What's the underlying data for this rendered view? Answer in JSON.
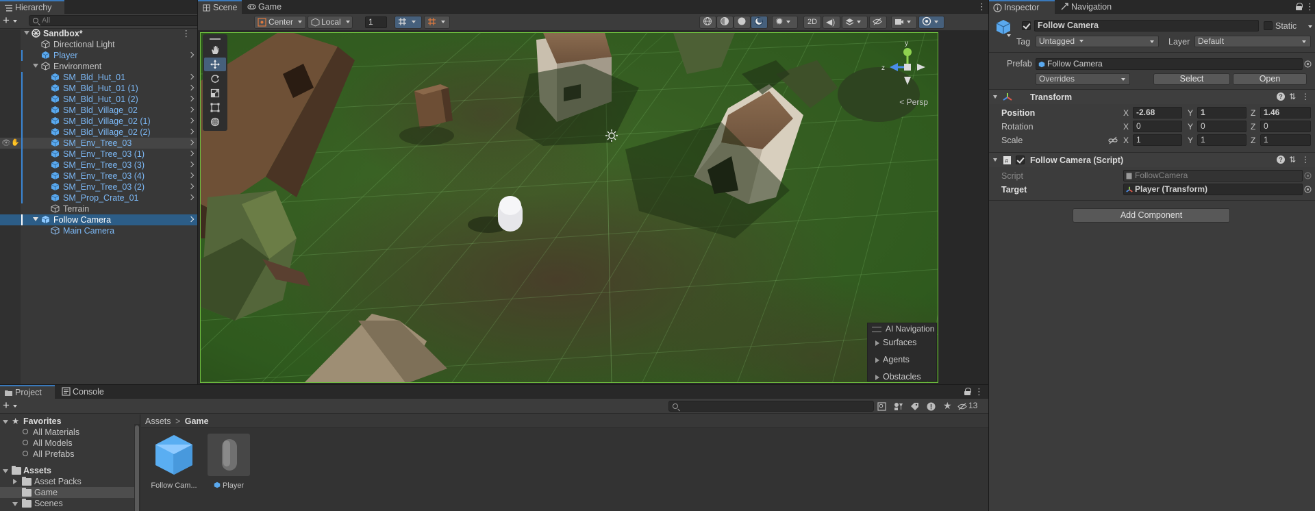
{
  "colors": {
    "accent": "#3a79bb",
    "selection": "#2c5d87",
    "prefab_blue": "#7cb8f5",
    "grid_green": "#6fbf3f"
  },
  "hierarchy": {
    "tab": "Hierarchy",
    "add_label": "+",
    "search_placeholder": "All",
    "scene_name": "Sandbox*",
    "items": [
      {
        "label": "Directional Light"
      },
      {
        "label": "Player"
      },
      {
        "label": "Environment"
      },
      {
        "label": "SM_Bld_Hut_01"
      },
      {
        "label": "SM_Bld_Hut_01 (1)"
      },
      {
        "label": "SM_Bld_Hut_01 (2)"
      },
      {
        "label": "SM_Bld_Village_02"
      },
      {
        "label": "SM_Bld_Village_02 (1)"
      },
      {
        "label": "SM_Bld_Village_02 (2)"
      },
      {
        "label": "SM_Env_Tree_03"
      },
      {
        "label": "SM_Env_Tree_03 (1)"
      },
      {
        "label": "SM_Env_Tree_03 (3)"
      },
      {
        "label": "SM_Env_Tree_03 (4)"
      },
      {
        "label": "SM_Env_Tree_03 (2)"
      },
      {
        "label": "SM_Prop_Crate_01"
      },
      {
        "label": "Terrain"
      },
      {
        "label": "Follow Camera"
      },
      {
        "label": "Main Camera"
      }
    ]
  },
  "scene": {
    "tabs": [
      "Scene",
      "Game"
    ],
    "toolbar": {
      "pivot": "Center",
      "space": "Local",
      "snap_value": "1",
      "mode_2d": "2D"
    },
    "persp_label": "< Persp",
    "ai_nav": {
      "title": "AI Navigation",
      "items": [
        "Surfaces",
        "Agents",
        "Obstacles"
      ]
    }
  },
  "inspector": {
    "tabs": [
      "Inspector",
      "Navigation"
    ],
    "object_name": "Follow Camera",
    "static_label": "Static",
    "tag_label": "Tag",
    "tag_value": "Untagged",
    "layer_label": "Layer",
    "layer_value": "Default",
    "prefab_label": "Prefab",
    "prefab_value": "Follow Camera",
    "overrides": "Overrides",
    "select": "Select",
    "open": "Open",
    "transform": {
      "title": "Transform",
      "position_label": "Position",
      "position": {
        "x": "-2.68",
        "y": "1",
        "z": "1.46"
      },
      "rotation_label": "Rotation",
      "rotation": {
        "x": "0",
        "y": "0",
        "z": "0"
      },
      "scale_label": "Scale",
      "scale": {
        "x": "1",
        "y": "1",
        "z": "1"
      }
    },
    "axis": {
      "x": "X",
      "y": "Y",
      "z": "Z"
    },
    "script_comp": {
      "title": "Follow Camera (Script)",
      "script_label": "Script",
      "script_value": "FollowCamera",
      "target_label": "Target",
      "target_value": "Player (Transform)"
    },
    "add_component": "Add Component"
  },
  "project": {
    "tabs": [
      "Project",
      "Console"
    ],
    "add_label": "+",
    "hidden_count": "13",
    "tree": {
      "favorites": "Favorites",
      "fav_items": [
        "All Materials",
        "All Models",
        "All Prefabs"
      ],
      "assets": "Assets",
      "asset_items": [
        "Asset Packs",
        "Game",
        "Scenes"
      ]
    },
    "breadcrumb": {
      "root": "Assets",
      "sep": ">",
      "current": "Game"
    },
    "assets": [
      {
        "label": "Follow Cam..."
      },
      {
        "label": "Player"
      }
    ]
  }
}
